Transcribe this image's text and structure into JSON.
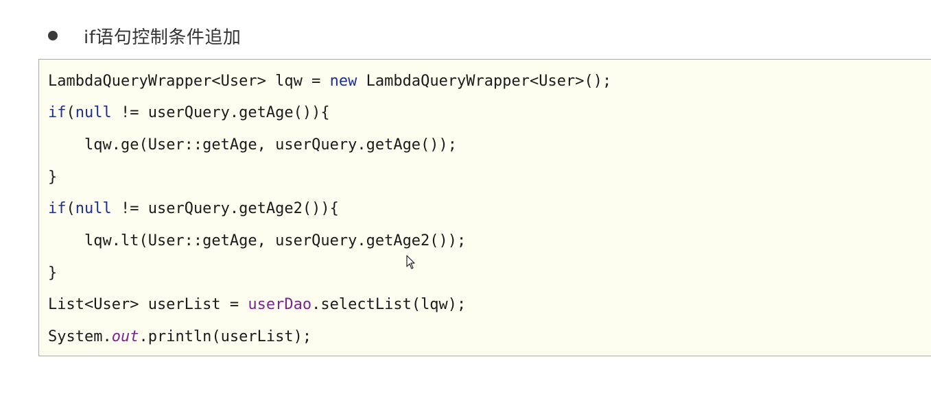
{
  "section": {
    "heading": "if语句控制条件追加"
  },
  "code": {
    "lines": [
      {
        "indent": "",
        "segments": [
          {
            "text": "LambdaQueryWrapper<User> lqw = ",
            "type": "plain"
          },
          {
            "text": "new",
            "type": "keyword"
          },
          {
            "text": " LambdaQueryWrapper<User>();",
            "type": "plain"
          }
        ]
      },
      {
        "indent": "",
        "segments": [
          {
            "text": "if",
            "type": "keyword"
          },
          {
            "text": "(",
            "type": "plain"
          },
          {
            "text": "null",
            "type": "keyword"
          },
          {
            "text": " != userQuery.getAge()){",
            "type": "plain"
          }
        ]
      },
      {
        "indent": "    ",
        "segments": [
          {
            "text": "lqw.ge(User::getAge, userQuery.getAge());",
            "type": "plain"
          }
        ]
      },
      {
        "indent": "",
        "segments": [
          {
            "text": "}",
            "type": "plain"
          }
        ]
      },
      {
        "indent": "",
        "segments": [
          {
            "text": "if",
            "type": "keyword"
          },
          {
            "text": "(",
            "type": "plain"
          },
          {
            "text": "null",
            "type": "keyword"
          },
          {
            "text": " != userQuery.getAge2()){",
            "type": "plain"
          }
        ]
      },
      {
        "indent": "    ",
        "segments": [
          {
            "text": "lqw.lt(User::getAge, userQuery.getAge2());",
            "type": "plain"
          }
        ]
      },
      {
        "indent": "",
        "segments": [
          {
            "text": "}",
            "type": "plain"
          }
        ]
      },
      {
        "indent": "",
        "segments": [
          {
            "text": "List<User> userList = ",
            "type": "plain"
          },
          {
            "text": "userDao",
            "type": "field"
          },
          {
            "text": ".selectList(lqw);",
            "type": "plain"
          }
        ]
      },
      {
        "indent": "",
        "segments": [
          {
            "text": "System.",
            "type": "plain"
          },
          {
            "text": "out",
            "type": "static-field"
          },
          {
            "text": ".println(userList);",
            "type": "plain"
          }
        ]
      }
    ]
  }
}
